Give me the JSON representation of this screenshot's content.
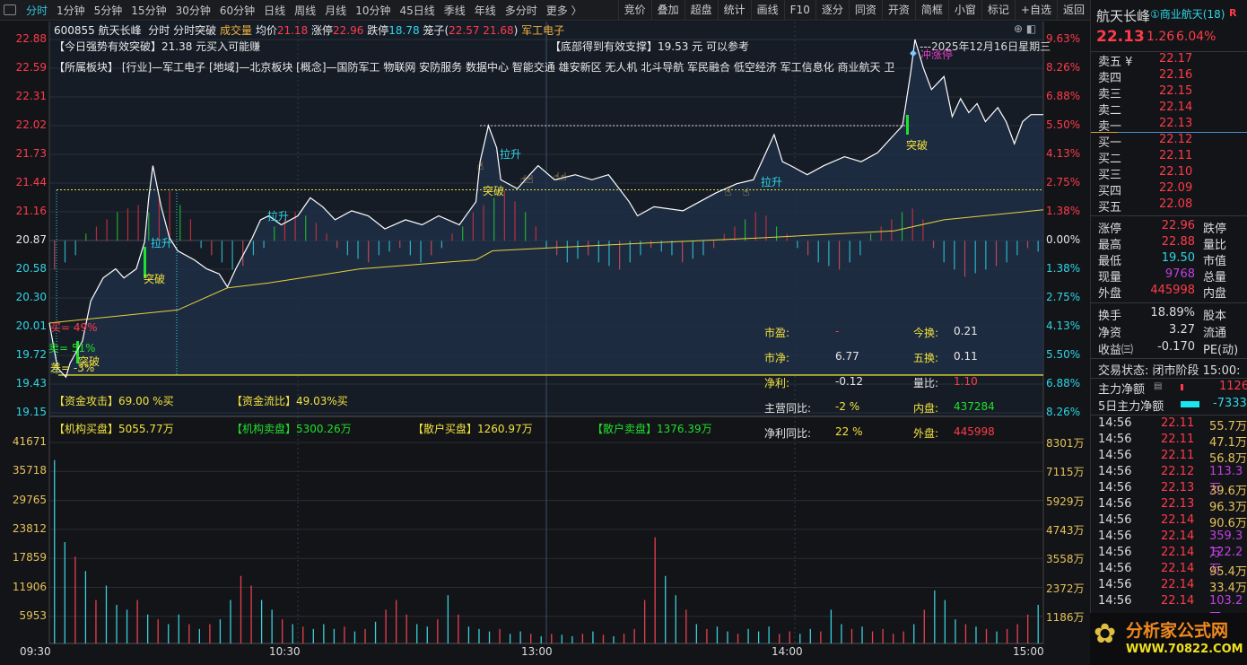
{
  "toolbar": {
    "tabs": [
      "分时",
      "1分钟",
      "5分钟",
      "15分钟",
      "30分钟",
      "60分钟",
      "日线",
      "周线",
      "月线",
      "10分钟",
      "45日线",
      "季线",
      "年线",
      "多分时",
      "更多 〉"
    ],
    "buttons": [
      "竞价",
      "叠加",
      "超盘",
      "统计",
      "画线",
      "F10",
      "逐分",
      "同资",
      "开资",
      "简框",
      "小窗",
      "标记",
      "+自选",
      "返回"
    ]
  },
  "info": {
    "code": "600855",
    "name": "航天长峰",
    "mode": "分时",
    "indicator": "分时突破",
    "vol_label": "成交量",
    "avg_label": "均价",
    "avg": "21.18",
    "up_label": "涨停",
    "up": "22.96",
    "down_label": "跌停",
    "down": "18.78",
    "cage_label": "笼子(",
    "cage": "22.57 21.68",
    ")": ")",
    "sector": "军工电子"
  },
  "signals": {
    "strong": "【今日强势有效突破】21.38 元买入可能赚",
    "support": "【底部得到有效支撑】19.53 元 可以参考",
    "date": "---2025年12月16日星期三",
    "boards": "【所属板块】 [行业]—军工电子 [地域]—北京板块 [概念]—国防军工 物联网 安防服务 数据中心 智能交通 雄安新区 无人机 北斗导航 军民融合 低空经济 军工信息化 商业航天 卫",
    "limit_hit": "冲涨停",
    "pull": "拉升",
    "break": "突破"
  },
  "price_axis": {
    "left": [
      "22.88",
      "22.59",
      "22.31",
      "22.02",
      "21.73",
      "21.44",
      "21.16",
      "20.87",
      "20.58",
      "20.30",
      "20.01",
      "19.72",
      "19.43",
      "19.15"
    ],
    "right": [
      "9.63%",
      "8.26%",
      "6.88%",
      "5.50%",
      "4.13%",
      "2.75%",
      "1.38%",
      "0.00%",
      "1.38%",
      "2.75%",
      "4.13%",
      "5.50%",
      "6.88%",
      "8.26%"
    ]
  },
  "vol_axis": {
    "left": [
      "41671",
      "35718",
      "29765",
      "23812",
      "17859",
      "11906",
      "5953"
    ],
    "right": [
      "8301万",
      "7115万",
      "5929万",
      "4743万",
      "3558万",
      "2372万",
      "1186万"
    ]
  },
  "time_axis": [
    "09:30",
    "10:30",
    "13:00",
    "14:00",
    "15:00"
  ],
  "ratio": {
    "buy": "买= 49%",
    "sell": "卖= 51%",
    "diff": "差= -3%"
  },
  "fund": {
    "attack": "【资金攻击】69.00 %买",
    "flow": "【资金流比】49.03%买",
    "inst_buy": "【机构买盘】5055.77万",
    "inst_sell": "【机构卖盘】5300.26万",
    "retail_buy": "【散户买盘】1260.97万",
    "retail_sell": "【散户卖盘】1376.39万"
  },
  "fin": [
    {
      "l": "市盈:",
      "v": "-",
      "l2": "今换:",
      "v2": "0.21"
    },
    {
      "l": "市净:",
      "v": "6.77",
      "l2": "五换:",
      "v2": "0.11"
    },
    {
      "l": "净利:",
      "v": "-0.12",
      "l2": "量比:",
      "v2": "1.10"
    },
    {
      "l": "主营同比:",
      "v": "-2 %",
      "l2": "内盘:",
      "v2": "437284"
    },
    {
      "l": "净利同比:",
      "v": "22 %",
      "l2": "外盘:",
      "v2": "445998"
    }
  ],
  "panel": {
    "name": "航天长峰",
    "concept": "①商业航天(18)",
    "r": "R",
    "price": "22.13",
    "chg": "1.26",
    "pct": "6.04%",
    "asks": [
      {
        "l": "卖五 ¥",
        "p": "22.17"
      },
      {
        "l": "卖四",
        "p": "22.16"
      },
      {
        "l": "卖三",
        "p": "22.15"
      },
      {
        "l": "卖二",
        "p": "22.14"
      },
      {
        "l": "卖一",
        "p": "22.13"
      }
    ],
    "bids": [
      {
        "l": "买一",
        "p": "22.12"
      },
      {
        "l": "买二",
        "p": "22.11"
      },
      {
        "l": "买三",
        "p": "22.10"
      },
      {
        "l": "买四",
        "p": "22.09"
      },
      {
        "l": "买五",
        "p": "22.08"
      }
    ],
    "stats": [
      {
        "l": "涨停",
        "v": "22.96",
        "l2": "跌停"
      },
      {
        "l": "最高",
        "v": "22.88",
        "l2": "量比"
      },
      {
        "l": "最低",
        "v": "19.50",
        "l2": "市值"
      },
      {
        "l": "现量",
        "v": "9768",
        "l2": "总量"
      },
      {
        "l": "外盘",
        "v": "445998",
        "l2": "内盘"
      }
    ],
    "stats2": [
      {
        "l": "换手",
        "v": "18.89%",
        "l2": "股本"
      },
      {
        "l": "净资",
        "v": "3.27",
        "l2": "流通"
      },
      {
        "l": "收益㈢",
        "v": "-0.170",
        "l2": "PE(动)"
      }
    ],
    "status": "交易状态: 闭市阶段 15:00:",
    "main_net_label": "主力净额",
    "main_net": "1126",
    "net5_label": "5日主力净额",
    "net5": "-7333",
    "trades": [
      {
        "t": "14:56",
        "p": "22.11",
        "v": "55.7万"
      },
      {
        "t": "14:56",
        "p": "22.11",
        "v": "47.1万"
      },
      {
        "t": "14:56",
        "p": "22.11",
        "v": "56.8万"
      },
      {
        "t": "14:56",
        "p": "22.12",
        "v": "113.3万",
        "big": true
      },
      {
        "t": "14:56",
        "p": "22.13",
        "v": "39.6万"
      },
      {
        "t": "14:56",
        "p": "22.13",
        "v": "96.3万"
      },
      {
        "t": "14:56",
        "p": "22.14",
        "v": "90.6万"
      },
      {
        "t": "14:56",
        "p": "22.14",
        "v": "359.3万",
        "big": true
      },
      {
        "t": "14:56",
        "p": "22.14",
        "v": "122.2万",
        "big": true
      },
      {
        "t": "14:56",
        "p": "22.14",
        "v": "95.4万"
      },
      {
        "t": "14:56",
        "p": "22.14",
        "v": "33.4万"
      },
      {
        "t": "14:56",
        "p": "22.14",
        "v": "103.2万",
        "big": true
      }
    ],
    "logo_cn": "分析家公式网",
    "logo_url": "WWW.70822.COM"
  },
  "colors": {
    "up": "#ff3b4a",
    "down": "#2ed6e6",
    "price_line": "#ffffff",
    "avg_line": "#e6d33c",
    "accent": "#2ec4dc"
  },
  "chart_data": {
    "type": "line",
    "prev_close": 20.87,
    "ylim": [
      19.15,
      22.88
    ],
    "minutes_total": 240,
    "price": [
      [
        0,
        20.05
      ],
      [
        2,
        19.6
      ],
      [
        4,
        19.51
      ],
      [
        5,
        19.65
      ],
      [
        8,
        19.87
      ],
      [
        10,
        20.27
      ],
      [
        13,
        20.5
      ],
      [
        16,
        20.59
      ],
      [
        18,
        20.5
      ],
      [
        21,
        20.59
      ],
      [
        23,
        20.86
      ],
      [
        24,
        21.3
      ],
      [
        25,
        21.62
      ],
      [
        27,
        21.21
      ],
      [
        29,
        20.9
      ],
      [
        31,
        20.77
      ],
      [
        35,
        20.68
      ],
      [
        38,
        20.59
      ],
      [
        41,
        20.54
      ],
      [
        43,
        20.41
      ],
      [
        45,
        20.59
      ],
      [
        49,
        20.9
      ],
      [
        51,
        21.08
      ],
      [
        53,
        21.12
      ],
      [
        56,
        21.03
      ],
      [
        60,
        21.12
      ],
      [
        63,
        21.3
      ],
      [
        66,
        21.21
      ],
      [
        69,
        21.08
      ],
      [
        73,
        21.17
      ],
      [
        77,
        21.12
      ],
      [
        81,
        20.99
      ],
      [
        86,
        21.08
      ],
      [
        90,
        21.03
      ],
      [
        94,
        21.12
      ],
      [
        99,
        21.03
      ],
      [
        103,
        21.26
      ],
      [
        104,
        21.66
      ],
      [
        106,
        22.02
      ],
      [
        108,
        21.8
      ],
      [
        109,
        21.48
      ],
      [
        113,
        21.39
      ],
      [
        116,
        21.53
      ],
      [
        118,
        21.62
      ],
      [
        122,
        21.48
      ],
      [
        127,
        21.53
      ],
      [
        131,
        21.48
      ],
      [
        135,
        21.53
      ],
      [
        140,
        21.26
      ],
      [
        142,
        21.12
      ],
      [
        146,
        21.21
      ],
      [
        153,
        21.17
      ],
      [
        157,
        21.26
      ],
      [
        161,
        21.35
      ],
      [
        166,
        21.44
      ],
      [
        170,
        21.48
      ],
      [
        172,
        21.66
      ],
      [
        175,
        21.93
      ],
      [
        177,
        21.66
      ],
      [
        179,
        21.62
      ],
      [
        183,
        21.53
      ],
      [
        187,
        21.62
      ],
      [
        192,
        21.71
      ],
      [
        196,
        21.66
      ],
      [
        200,
        21.75
      ],
      [
        204,
        21.93
      ],
      [
        206,
        22.02
      ],
      [
        208,
        22.56
      ],
      [
        209,
        22.88
      ],
      [
        211,
        22.6
      ],
      [
        213,
        22.38
      ],
      [
        216,
        22.51
      ],
      [
        218,
        22.11
      ],
      [
        220,
        22.29
      ],
      [
        222,
        22.15
      ],
      [
        224,
        22.24
      ],
      [
        226,
        22.06
      ],
      [
        229,
        22.2
      ],
      [
        231,
        22.06
      ],
      [
        233,
        21.84
      ],
      [
        235,
        22.06
      ],
      [
        237,
        22.13
      ],
      [
        240,
        22.13
      ]
    ],
    "avg": [
      [
        0,
        20.05
      ],
      [
        31,
        20.18
      ],
      [
        43,
        20.4
      ],
      [
        53,
        20.45
      ],
      [
        75,
        20.59
      ],
      [
        103,
        20.68
      ],
      [
        107,
        20.77
      ],
      [
        140,
        20.84
      ],
      [
        172,
        20.9
      ],
      [
        204,
        20.97
      ],
      [
        216,
        21.08
      ],
      [
        240,
        21.18
      ]
    ],
    "levels": {
      "breakout": 21.38,
      "support": 19.53,
      "high_mark": 22.02
    },
    "volume": [
      38000,
      21000,
      18000,
      15000,
      9000,
      12000,
      8000,
      7000,
      9000,
      6000,
      5000,
      4000,
      6000,
      4000,
      3000,
      4000,
      5000,
      9000,
      14000,
      12000,
      9000,
      7000,
      5000,
      4000,
      3500,
      3000,
      4000,
      3000,
      3500,
      2500,
      3000,
      4500,
      7000,
      9000,
      6000,
      4000,
      3500,
      5000,
      10000,
      6000,
      3500,
      3000,
      2500,
      3000,
      2000,
      2500,
      2000,
      1500,
      2000,
      1800,
      1500,
      2000,
      2500,
      1800,
      1500,
      2000,
      3000,
      9000,
      22000,
      14000,
      10000,
      7000,
      4000,
      3000,
      3500,
      2500,
      2000,
      3000,
      2500,
      3500,
      2000,
      2500,
      2000,
      3000,
      2500,
      7000,
      4000,
      3000,
      3500,
      2500,
      3000,
      2000,
      2500,
      4000,
      7000,
      11000,
      9000,
      5000,
      4000,
      3500,
      3000,
      2500,
      3000,
      4000,
      6000,
      8000
    ],
    "volume_dir": "ggrgrgggrgrggrgrggrrggrgrgggrgrgrrrggrgrgggrggrgrggrgrgrrrrggrgrggrgggrrggrggrgrrrrgrgggrgrgrrr",
    "flow": [
      -40,
      -30,
      -20,
      10,
      20,
      30,
      40,
      45,
      50,
      40,
      60,
      70,
      50,
      30,
      -10,
      -20,
      -30,
      -40,
      -35,
      -20,
      -10,
      20,
      30,
      40,
      35,
      25,
      10,
      -10,
      -20,
      -25,
      -30,
      -20,
      -15,
      -10,
      -20,
      -30,
      -20,
      -10,
      10,
      20,
      40,
      50,
      60,
      70,
      55,
      40,
      20,
      -10,
      -20,
      -30,
      -25,
      -20,
      -30,
      -35,
      -40,
      -30,
      -20,
      -10,
      -15,
      -20,
      -30,
      -25,
      -20,
      -10,
      10,
      20,
      30,
      40,
      35,
      20,
      10,
      -10,
      -20,
      -30,
      -35,
      -40,
      -30,
      -20,
      10,
      20,
      30,
      40,
      45,
      30,
      -10,
      -30,
      -40,
      -50,
      -45,
      -40,
      -35,
      -30,
      -20,
      -10,
      -15
    ]
  }
}
